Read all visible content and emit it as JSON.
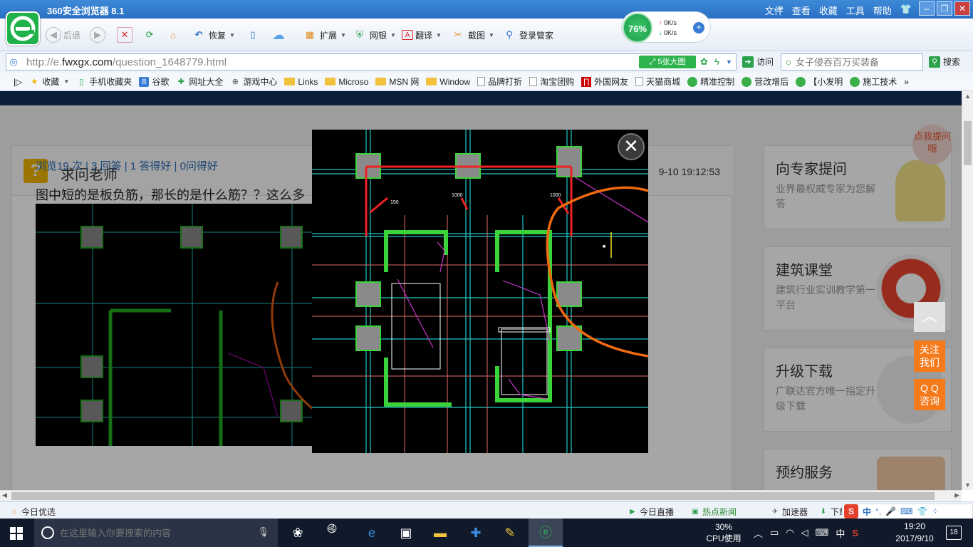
{
  "window": {
    "title": "360安全浏览器 8.1",
    "menus": [
      "文件",
      "查看",
      "收藏",
      "工具",
      "帮助"
    ]
  },
  "toolbar": {
    "back": "后退",
    "restore": "恢复",
    "extend": "扩展",
    "bank": "网银",
    "translate": "翻译",
    "screenshot": "截图",
    "login": "登录管家"
  },
  "perf": {
    "cpu_percent": "76%",
    "upload": "0K/s",
    "download": "0K/s"
  },
  "address": {
    "url_prefix": "http://e.",
    "url_host": "fwxgx.com",
    "url_path": "/question_1648779.html",
    "big_image_label": "5张大图",
    "visit_label": "访问",
    "search_placeholder": "女子侵吞百万买装备",
    "search_label": "搜索"
  },
  "favorites": [
    "收藏",
    "手机收藏夹",
    "谷歌",
    "网址大全",
    "游戏中心",
    "Links",
    "Microso",
    "MSN 网",
    "Window",
    "品牌打折",
    "淘宝团购",
    "外国网友",
    "天猫商城",
    "精准控制",
    "营改增后",
    "【小发明",
    "施工技术"
  ],
  "question": {
    "title": "求问老师",
    "date": "9-10 19:12:53",
    "stats": "浏览19 次 | 3 回答 | 1 答得好 | 0问得好",
    "text": "图中短的是板负筋，那长的是什么筋？？这么多"
  },
  "sidebar": {
    "cards": [
      {
        "title": "向专家提问",
        "sub": "业界最权威专家为您解答",
        "badge": "点我提问哦"
      },
      {
        "title": "建筑课堂",
        "sub": "建筑行业实训教学第一平台"
      },
      {
        "title": "升级下载",
        "sub": "广联达官方唯一指定升级下载"
      },
      {
        "title": "预约服务",
        "sub": ""
      }
    ]
  },
  "floats": {
    "follow": "关注我们",
    "qq": "Q Q咨询"
  },
  "statusbar": {
    "left": "今日优选",
    "live": "今日直播",
    "news": "热点新闻",
    "accel": "加速器",
    "download": "下载",
    "ime_lang": "中"
  },
  "taskbar": {
    "search_placeholder": "在这里输入你要搜索的内容",
    "cpu_value": "30%",
    "cpu_label": "CPU使用",
    "ime": "中",
    "time": "19:20",
    "date": "2017/9/10",
    "notifications": "18"
  },
  "colors": {
    "accent": "#2a6fc4",
    "green": "#20b24a",
    "orange": "#f57a1c"
  }
}
